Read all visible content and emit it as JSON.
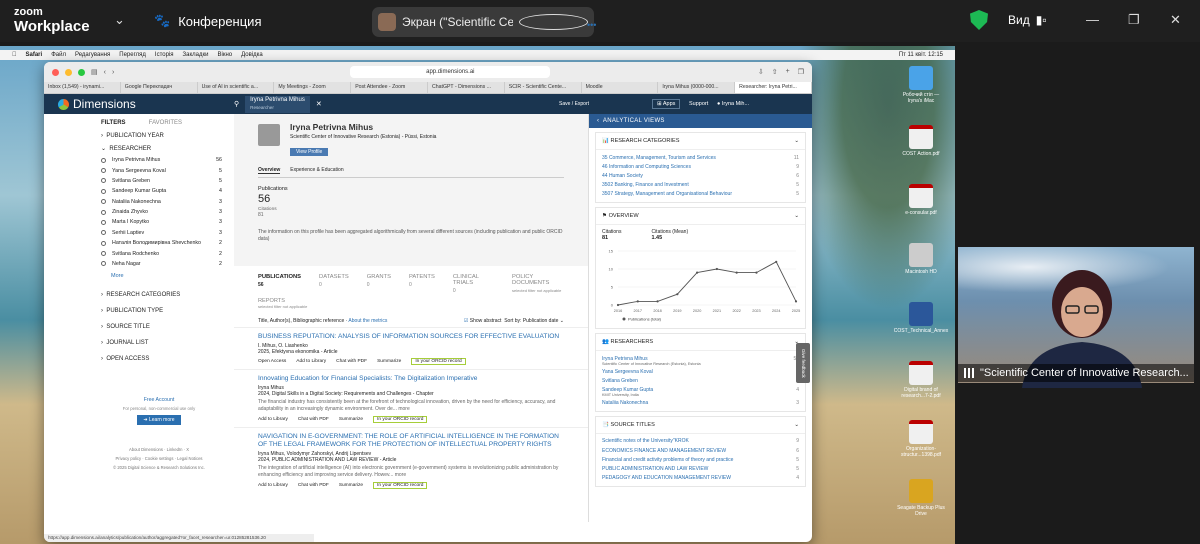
{
  "zoom": {
    "logo_top": "zoom",
    "logo_bottom": "Workplace",
    "meeting_label": "Конференция",
    "share_label": "Экран (\"Scientific Center of Innov",
    "view_label": "Вид"
  },
  "mac_menu": {
    "items": [
      "Safari",
      "Файл",
      "Редагування",
      "Перегляд",
      "Історія",
      "Закладки",
      "Вікно",
      "Довідка"
    ],
    "clock": "Пт 11 квіт. 12:15"
  },
  "desktop_icons": [
    {
      "label": "Робочий стіл — Iryna's iMac",
      "icon": "folder-icon",
      "color": "#4aa3e8"
    },
    {
      "label": "COST Action.pdf",
      "icon": "pdf-icon",
      "color": "#f0f0f0"
    },
    {
      "label": "e-consular.pdf",
      "icon": "pdf-icon",
      "color": "#f0f0f0"
    },
    {
      "label": "Macintosh HD",
      "icon": "disk-icon",
      "color": "#cccccc"
    },
    {
      "label": "COST_Technical_Annex",
      "icon": "word-icon",
      "color": "#2b579a"
    },
    {
      "label": "Digital brand of research...7-2.pdf",
      "icon": "pdf-icon",
      "color": "#f0f0f0"
    },
    {
      "label": "Organization-structur...1398.pdf",
      "icon": "pdf-icon",
      "color": "#f0f0f0"
    },
    {
      "label": "Seagate Backup Plus Drive",
      "icon": "drive-icon",
      "color": "#d9a520"
    }
  ],
  "browser": {
    "url": "app.dimensions.ai",
    "tabs": [
      "Inbox (1,549) - irynami...",
      "Google Перекладач",
      "Use of AI in scientific a...",
      "My Meetings - Zoom",
      "Post Attendee - Zoom",
      "ChatGPT - Dimensions ...",
      "SCIR - Scientific Cente...",
      "Moodle",
      "Iryna Mihus (0000-000...",
      "Researcher: Iryna Petri..."
    ],
    "status_url": "https://app.dimensions.ai/analytics/publication/author/aggregated?or_facet_researcher=ur.01285281536.20"
  },
  "dimensions": {
    "logo": "Dimensions",
    "chip_name": "Iryna Petrivna Mihus",
    "chip_role": "Researcher",
    "save_export": "Save / Export",
    "apps": "Apps",
    "support": "Support",
    "user": "Iryna Mih..."
  },
  "filters": {
    "title": "FILTERS",
    "favorites": "FAVORITES",
    "publication_year": "PUBLICATION YEAR",
    "researcher": "RESEARCHER",
    "researchers": [
      {
        "name": "Iryna Petrivna Mihus",
        "count": "56"
      },
      {
        "name": "Yana Sergeevna Koval",
        "count": "5"
      },
      {
        "name": "Svitlana Greben",
        "count": "5"
      },
      {
        "name": "Sandeep Kumar Gupta",
        "count": "4"
      },
      {
        "name": "Nataliia Nakonechna",
        "count": "3"
      },
      {
        "name": "Zinaida Zhyvko",
        "count": "3"
      },
      {
        "name": "Marta I Kopytko",
        "count": "3"
      },
      {
        "name": "Serhii Laptiev",
        "count": "3"
      },
      {
        "name": "Наталія Володимирівна Shevchenko",
        "count": "2"
      },
      {
        "name": "Svitlana Rodchenko",
        "count": "2"
      },
      {
        "name": "Neha Nagar",
        "count": "2"
      }
    ],
    "more": "More",
    "sections": [
      "RESEARCH CATEGORIES",
      "PUBLICATION TYPE",
      "SOURCE TITLE",
      "JOURNAL LIST",
      "OPEN ACCESS"
    ],
    "free_account": "Free Account",
    "free_sub": "For personal, non-commercial use only",
    "learn_more": "Learn more",
    "footer1": "About Dimensions · LinkedIn · X",
    "footer2": "Privacy policy · Cookie settings · Legal Notices",
    "footer3": "© 2025 Digital Science & Research Solutions Inc."
  },
  "profile": {
    "name": "Iryna Petrivna Mihus",
    "affiliation": "Scientific Center of Innovative Research (Estonia) - Püssi, Estonia",
    "view_profile": "View Profile",
    "tab_overview": "Overview",
    "tab_exp": "Experience & Education",
    "publications_label": "Publications",
    "publications_value": "56",
    "citations_label": "Citations",
    "citations_value": "81",
    "info": "The information on this profile has been aggregated algorithmically from several different sources (including publication and public ORCID data)"
  },
  "result_tabs": [
    {
      "label": "PUBLICATIONS",
      "value": "56",
      "sub": ""
    },
    {
      "label": "DATASETS",
      "value": "0",
      "sub": ""
    },
    {
      "label": "GRANTS",
      "value": "0",
      "sub": ""
    },
    {
      "label": "PATENTS",
      "value": "0",
      "sub": ""
    },
    {
      "label": "CLINICAL TRIALS",
      "value": "0",
      "sub": ""
    },
    {
      "label": "POLICY DOCUMENTS",
      "value": "",
      "sub": "selected filter not applicable"
    }
  ],
  "reports": {
    "label": "REPORTS",
    "sub": "selected filter not applicable"
  },
  "sortbar": {
    "left": "Title, Author(s), Bibliographic reference",
    "about": "About the metrics",
    "show_abstract": "Show abstract",
    "sort": "Sort by: Publication date"
  },
  "articles": [
    {
      "title": "BUSINESS REPUTATION: ANALYSIS OF INFORMATION SOURCES FOR EFFECTIVE EVALUATION",
      "authors": "I. Mihus, O. Liashenko",
      "meta": "2025, Efektyvna ekonomika - Article",
      "abstract": "",
      "actions": [
        "Open Access",
        "Add to Library",
        "Chat with PDF",
        "Summarize",
        "In your ORCID record"
      ]
    },
    {
      "title": "Innovating Education for Financial Specialists: The Digitalization Imperative",
      "authors": "Iryna Mihus",
      "meta": "2024, Digital Skills in a Digital Society: Requirements and Challenges - Chapter",
      "abstract": "The financial industry has consistently been at the forefront of technological innovation, driven by the need for efficiency, accuracy, and adaptability in an increasingly dynamic environment. Over de...  more",
      "actions": [
        "Add to Library",
        "Chat with PDF",
        "Summarize",
        "In your ORCID record"
      ]
    },
    {
      "title": "NAVIGATION IN E-GOVERNMENT: THE ROLE OF ARTIFICIAL INTELLIGENCE IN THE FORMATION OF THE LEGAL FRAMEWORK FOR THE PROTECTION OF INTELLECTUAL PROPERTY RIGHTS",
      "authors": "Iryna Mihus, Volodymyr Zahorskyi, Andrij Lipentsev",
      "meta": "2024, PUBLIC ADMINISTRATION AND LAW REVIEW - Article",
      "abstract": "The integration of artificial intelligence (AI) into electronic government (e-government) systems is revolutionizing public administration by enhancing efficiency and improving service delivery. Howev...  more",
      "actions": [
        "Add to Library",
        "Chat with PDF",
        "Summarize",
        "In your ORCID record"
      ]
    }
  ],
  "analytical": {
    "title": "ANALYTICAL VIEWS",
    "cat_title": "RESEARCH CATEGORIES",
    "categories": [
      {
        "name": "35 Commerce, Management, Tourism and Services",
        "count": "11"
      },
      {
        "name": "46 Information and Computing Sciences",
        "count": "9"
      },
      {
        "name": "44 Human Society",
        "count": "6"
      },
      {
        "name": "3502 Banking, Finance and Investment",
        "count": "5"
      },
      {
        "name": "3507 Strategy, Management and Organisational Behaviour",
        "count": "5"
      }
    ],
    "overview_title": "OVERVIEW",
    "citations_label": "Citations",
    "citations_value": "81",
    "mean_label": "Citations (Mean)",
    "mean_value": "1.45",
    "legend": "Publications (total)",
    "res_title": "RESEARCHERS",
    "researchers": [
      {
        "name": "Iryna Petrivna Mihus",
        "sub": "Scientific Center of Innovative Research (Estonia), Estonia",
        "count": "56"
      },
      {
        "name": "Yana Sergeevna Koval",
        "sub": "",
        "count": "5"
      },
      {
        "name": "Svitlana Greben",
        "sub": "",
        "count": "5"
      },
      {
        "name": "Sandeep Kumar Gupta",
        "sub": "KMIT University, India",
        "count": "4"
      },
      {
        "name": "Nataliia Nakonechna",
        "sub": "",
        "count": "3"
      }
    ],
    "src_title": "SOURCE TITLES",
    "sources": [
      {
        "name": "Scientific notes of the University\"KROK",
        "count": "9"
      },
      {
        "name": "ECONOMICS FINANCE AND MANAGEMENT REVIEW",
        "count": "6"
      },
      {
        "name": "Financial and credit activity problems of theory and practice",
        "count": "5"
      },
      {
        "name": "PUBLIC ADMINISTRATION AND LAW REVIEW",
        "count": "5"
      },
      {
        "name": "PEDAGOGY AND EDUCATION MANAGEMENT REVIEW",
        "count": "4"
      }
    ],
    "feedback": "Give feedback"
  },
  "chart_data": {
    "type": "line",
    "x": [
      2016,
      2017,
      2018,
      2019,
      2020,
      2021,
      2022,
      2023,
      2024,
      2025
    ],
    "series": [
      {
        "name": "Publications (total)",
        "values": [
          0,
          1,
          1,
          3,
          9,
          10,
          9,
          9,
          12,
          1
        ]
      }
    ],
    "ylim": [
      0,
      15
    ],
    "yticks": [
      0,
      5,
      10,
      15
    ],
    "legend": "bottom"
  },
  "participant": {
    "name": "\"Scientific Center of Innovative Research..."
  }
}
